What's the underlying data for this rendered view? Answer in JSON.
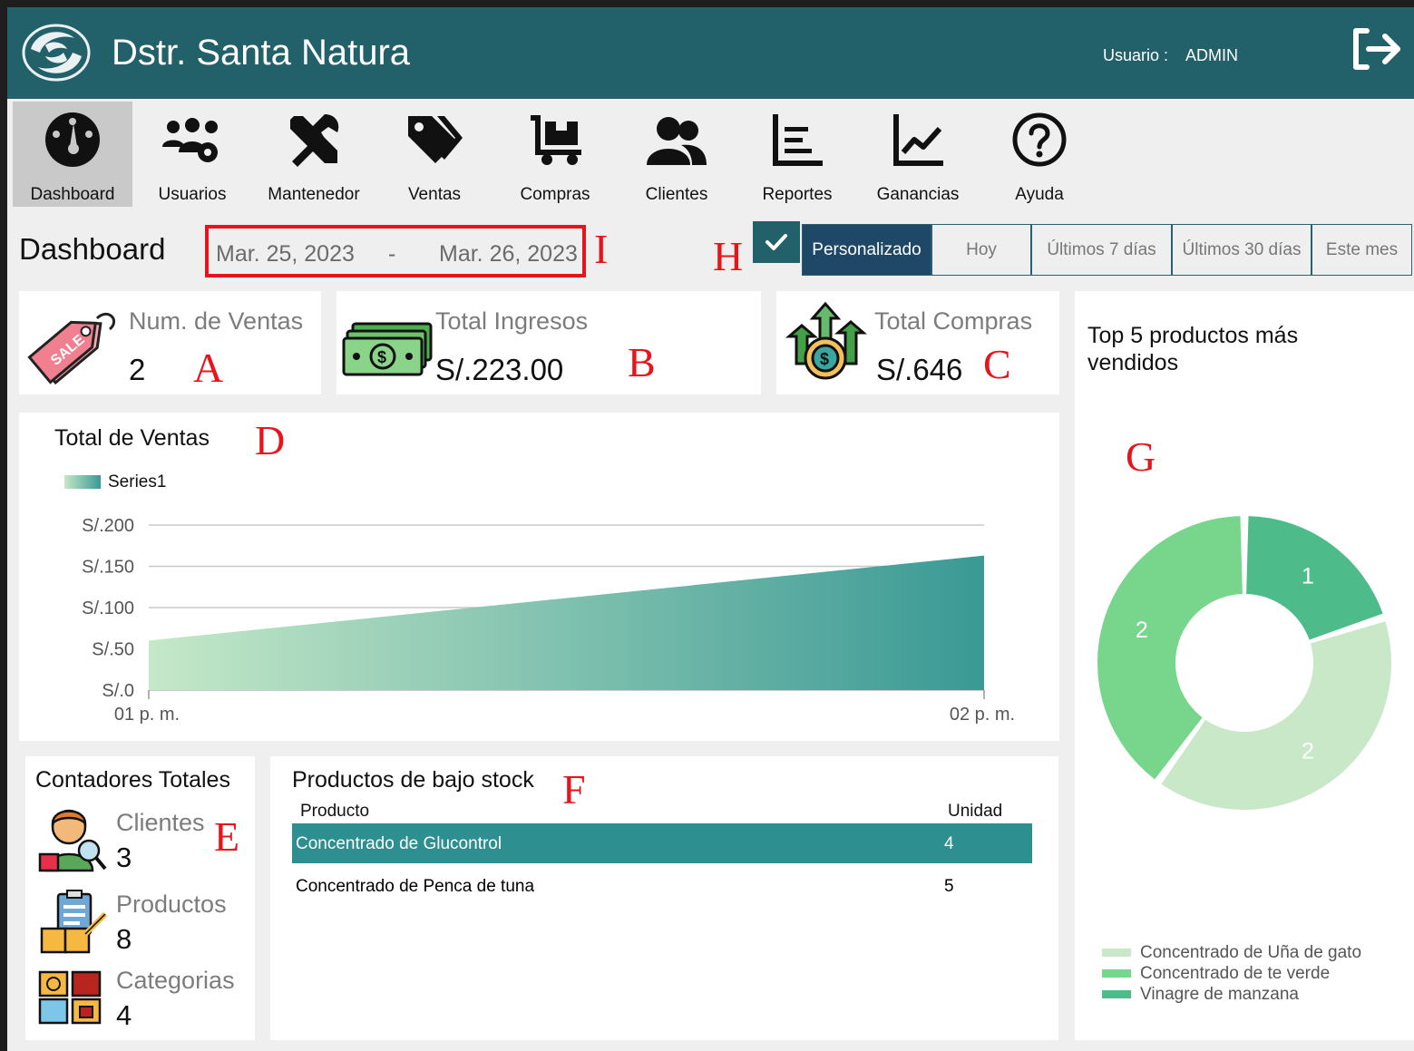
{
  "header": {
    "title": "Dstr. Santa Natura",
    "user_label": "Usuario :",
    "user_value": "ADMIN"
  },
  "nav": {
    "items": [
      {
        "label": "Dashboard",
        "icon": "dashboard-gauge-icon"
      },
      {
        "label": "Usuarios",
        "icon": "users-settings-icon"
      },
      {
        "label": "Mantenedor",
        "icon": "tools-icon"
      },
      {
        "label": "Ventas",
        "icon": "tags-icon"
      },
      {
        "label": "Compras",
        "icon": "dolly-cart-icon"
      },
      {
        "label": "Clientes",
        "icon": "clients-icon"
      },
      {
        "label": "Reportes",
        "icon": "report-icon"
      },
      {
        "label": "Ganancias",
        "icon": "line-chart-icon"
      },
      {
        "label": "Ayuda",
        "icon": "help-icon"
      }
    ]
  },
  "dashboard": {
    "title": "Dashboard",
    "date_start": "Mar. 25, 2023",
    "date_sep": "-",
    "date_end": "Mar. 26, 2023",
    "filters": [
      "Personalizado",
      "Hoy",
      "Últimos 7 días",
      "Últimos 30 días",
      "Este mes"
    ],
    "active_filter": "Personalizado"
  },
  "annotations": {
    "a": "A",
    "b": "B",
    "c": "C",
    "d": "D",
    "e": "E",
    "f": "F",
    "g": "G",
    "h": "H",
    "i": "I"
  },
  "cards": {
    "ventas": {
      "title": "Num. de Ventas",
      "value": "2"
    },
    "ingresos": {
      "title": "Total Ingresos",
      "value": "S/.223.00"
    },
    "compras": {
      "title": "Total Compras",
      "value": "S/.646"
    }
  },
  "chart_data": {
    "type": "area",
    "title": "Total de Ventas",
    "x": [
      "01 p. m.",
      "02 p. m."
    ],
    "series": [
      {
        "name": "Series1",
        "values": [
          60,
          163
        ]
      }
    ],
    "ylim": [
      0,
      200
    ],
    "yticks": [
      "S/.0",
      "S/.50",
      "S/.100",
      "S/.150",
      "S/.200"
    ],
    "grid": true,
    "legend": "top-left",
    "colors": {
      "start": "#c5e8c8",
      "end": "#3a9995"
    }
  },
  "counters": {
    "title": "Contadores Totales",
    "clientes": {
      "label": "Clientes",
      "value": "3"
    },
    "productos": {
      "label": "Productos",
      "value": "8"
    },
    "categorias": {
      "label": "Categorias",
      "value": "4"
    }
  },
  "stock": {
    "title": "Productos de bajo stock",
    "columns": [
      "Producto",
      "Unidad"
    ],
    "rows": [
      {
        "producto": "Concentrado de Glucontrol",
        "unidad": "4"
      },
      {
        "producto": "Concentrado de Penca de tuna",
        "unidad": "5"
      }
    ]
  },
  "top5": {
    "title_line1": "Top 5 productos más",
    "title_line2": "vendidos",
    "chart_data": {
      "type": "pie",
      "slices": [
        {
          "name": "Concentrado de Uña de gato",
          "value": 2,
          "color": "#c8e8c8"
        },
        {
          "name": "Concentrado de te verde",
          "value": 2,
          "color": "#77d68b"
        },
        {
          "name": "Vinagre de manzana",
          "value": 1,
          "color": "#4dbb8a"
        }
      ]
    }
  }
}
